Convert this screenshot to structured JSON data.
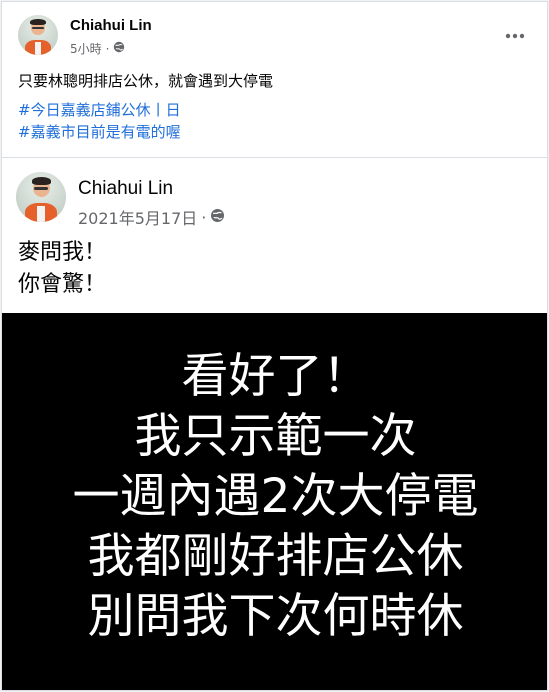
{
  "post": {
    "author": "Chiahui Lin",
    "time": "5小時",
    "separator": "·",
    "text": "只要林聰明排店公休，就會遇到大停電",
    "hashtags": [
      "#今日嘉義店鋪公休丨日",
      "#嘉義市目前是有電的喔"
    ],
    "more_icon": "more-horizontal-icon",
    "privacy_icon": "globe-icon"
  },
  "shared": {
    "author": "Chiahui Lin",
    "date": "2021年5月17日",
    "separator": "·",
    "text_lines": [
      "麥問我！",
      "你會驚！"
    ],
    "image_lines": [
      "看好了！",
      "我只示範一次",
      "一週內遇2次大停電",
      "我都剛好排店公休",
      "別問我下次何時休"
    ]
  },
  "colors": {
    "link": "#216fdb",
    "meta": "#65676b",
    "image_bg": "#000000",
    "image_text": "#ffffff"
  }
}
